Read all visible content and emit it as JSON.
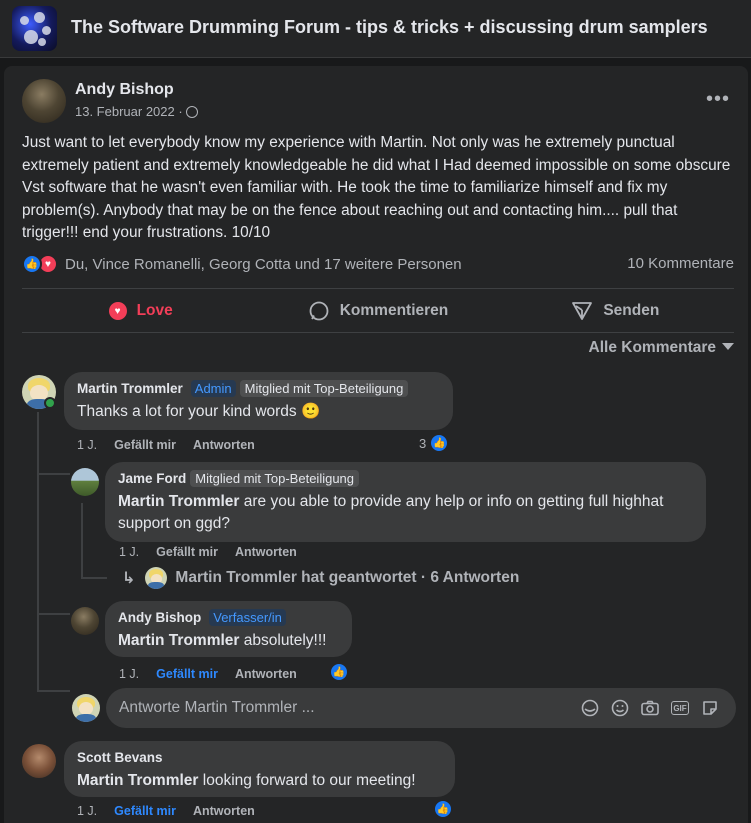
{
  "group": {
    "title": "The Software Drumming Forum - tips & tricks + discussing drum samplers"
  },
  "post": {
    "author": "Andy Bishop",
    "date": "13. Februar 2022 ·",
    "text": "Just want to let everybody know my experience with Martin. Not only was he extremely punctual extremely patient and extremely knowledgeable he did what I Had deemed impossible on some obscure Vst software that he wasn't even familiar with. He took the time to familiarize himself and fix my problem(s).   Anybody that may be on the fence about reaching out and contacting him.... pull that trigger!!! end your frustrations.   10/10",
    "reactors": "Du, Vince Romanelli, Georg Cotta und 17 weitere Personen",
    "comment_count": "10 Kommentare",
    "more_icon": "more-horizontal-icon",
    "privacy_icon": "globe-icon"
  },
  "actions": {
    "love": "Love",
    "comment": "Kommentieren",
    "send": "Senden"
  },
  "sort_label": "Alle Kommentare",
  "comments": [
    {
      "author": "Martin Trommler",
      "badge_admin": "Admin",
      "badge_top": "Mitglied mit Top-Beteiligung",
      "text": "Thanks a lot for your kind words 🙂",
      "time": "1 J.",
      "like": "Gefällt mir",
      "reply": "Antworten",
      "likes": "3"
    },
    {
      "author": "Jame Ford",
      "badge_top": "Mitglied mit Top-Beteiligung",
      "mention": "Martin Trommler",
      "text": " are you able to provide any help or info on getting full highhat support on ggd?",
      "time": "1 J.",
      "like": "Gefällt mir",
      "reply": "Antworten",
      "replies_link": "Martin Trommler hat geantwortet · 6 Antworten"
    },
    {
      "author": "Andy Bishop",
      "badge_author": "Verfasser/in",
      "mention": "Martin Trommler",
      "text": " absolutely!!!",
      "time": "1 J.",
      "like": "Gefällt mir",
      "reply": "Antworten"
    },
    {
      "author": "Scott Bevans",
      "mention": "Martin Trommler",
      "text": " looking forward to our meeting!",
      "time": "1 J.",
      "like": "Gefällt mir",
      "reply": "Antworten"
    }
  ],
  "reply_box": {
    "placeholder": "Antworte Martin Trommler ..."
  }
}
